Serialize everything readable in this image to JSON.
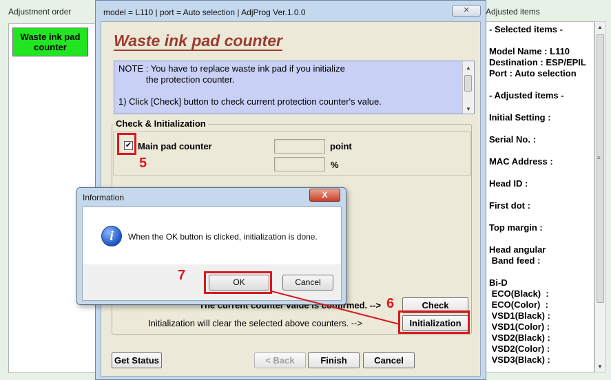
{
  "left_window": {
    "title": "Adjustment order",
    "items": [
      "Waste ink pad\ncounter"
    ]
  },
  "main_window": {
    "title": "model = L110 | port = Auto selection | AdjProg Ver.1.0.0",
    "close_glyph": "✕",
    "heading": "Waste ink pad counter",
    "note_lines": [
      "NOTE : You have to replace waste ink pad if you initialize",
      "           the protection counter.",
      "",
      "1) Click [Check] button to check current protection counter's value."
    ],
    "group_label": "Check & Initialization",
    "main_pad_label": "Main pad counter",
    "main_pad_checked": true,
    "check_mark": "✔",
    "point_unit": "point",
    "percent_unit": "%",
    "confirmed_text": "The current counter value is confirmed. -->",
    "init_text": "Initialization will clear the selected above counters. -->",
    "check_button": "Check",
    "initialization_button": "Initialization",
    "get_status_button": "Get Status",
    "back_button": "< Back",
    "finish_button": "Finish",
    "cancel_button": "Cancel"
  },
  "annotations": {
    "step5": "5",
    "step6": "6",
    "step7": "7",
    "color": "#d9191e"
  },
  "info_dialog": {
    "title": "Information",
    "close_glyph": "X",
    "icon": "info-icon",
    "message": "When the OK button is clicked, initialization is done.",
    "ok_button": "OK",
    "cancel_button": "Cancel"
  },
  "right_window": {
    "title": "Adjusted items",
    "lines": [
      "- Selected items -",
      "",
      "Model Name : L110",
      "Destination : ESP/EPIL",
      "Port : Auto selection",
      "",
      "- Adjusted items -",
      "",
      "Initial Setting :",
      "",
      "Serial No. :",
      "",
      "MAC Address :",
      "",
      "Head ID :",
      "",
      "First dot :",
      "",
      "Top margin :",
      "",
      "Head angular",
      " Band feed :",
      "",
      "Bi-D",
      " ECO(Black)  :",
      " ECO(Color)  :",
      " VSD1(Black) :",
      " VSD1(Color) :",
      " VSD2(Black) :",
      " VSD2(Color) :",
      " VSD3(Black) :"
    ]
  }
}
